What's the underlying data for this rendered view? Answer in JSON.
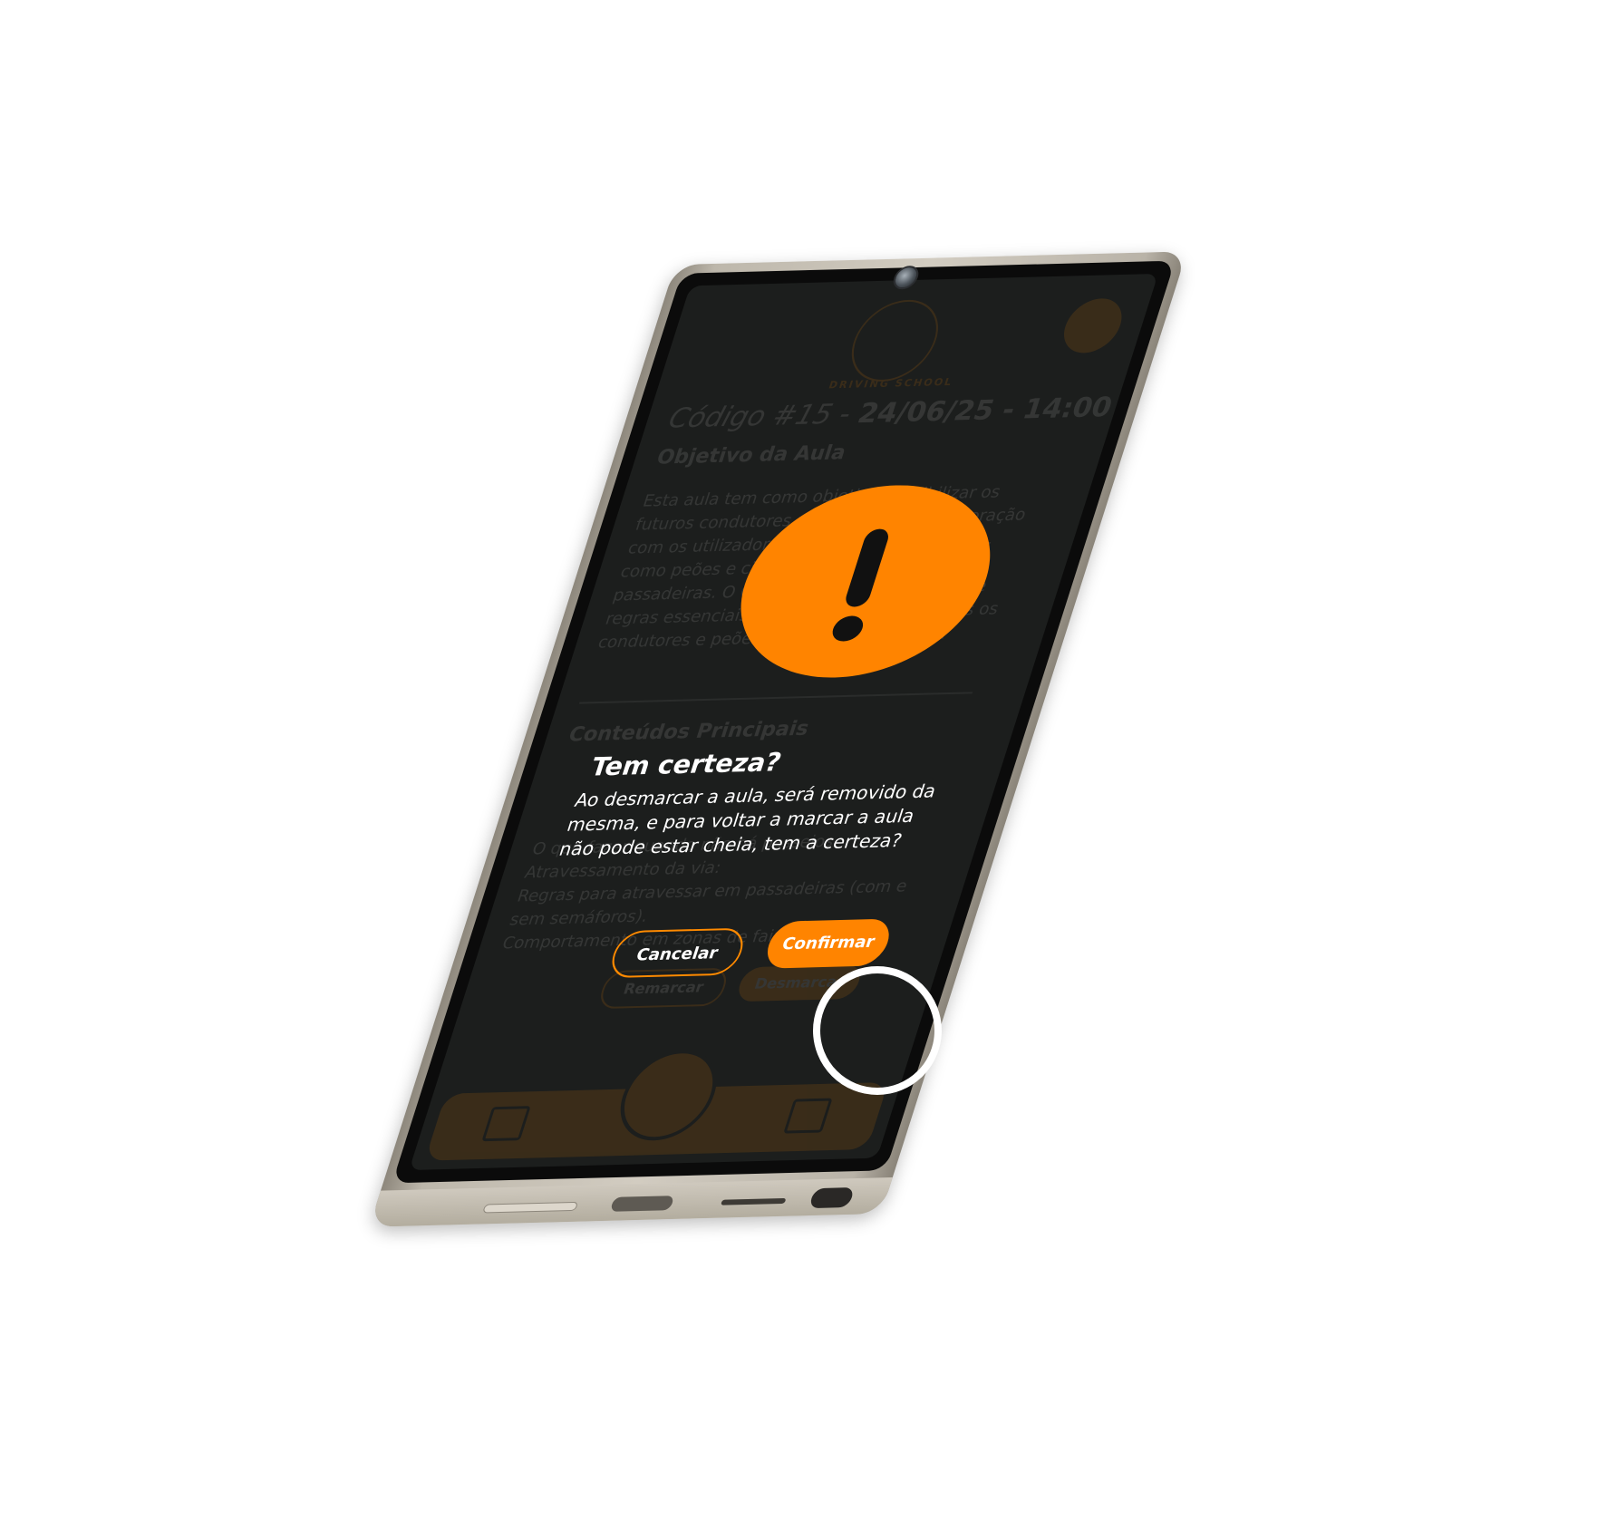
{
  "app": {
    "logo_text": "DRIVING SCHOOL",
    "lesson_title_prefix": "Código #15 - ",
    "lesson_title_date": "24/06/25 - 14:00",
    "objective_heading": "Objetivo da Aula",
    "objective_text": "Esta aula tem como objetivo sensibilizar os futuros condutores para a proteção e interação com os utilizadores mais vulneráveis da via, como peões e ciclistas, nos passeios e passadeiras. O Código da Estrada estabelece regras essenciais para a segurança de todos os condutores e peões para evitar acidentes.",
    "contents_heading": "Conteúdos Principais",
    "contents_items": [
      "O que fazer quando não há passeios.",
      "Atravessamento da via:",
      "Regras para atravessar em passadeiras (com e sem semáforos).",
      "Comportamento em zonas de faixas de peões."
    ],
    "bg_buttons": [
      "Remarcar",
      "Desmarcar"
    ]
  },
  "modal": {
    "title": "Tem certeza?",
    "message": "Ao desmarcar a aula, será removido da mesma, e para voltar a marcar a aula não pode estar cheia, tem a certeza?",
    "cancel_label": "Cancelar",
    "confirm_label": "Confirmar"
  },
  "icons": {
    "warning": "exclamation-icon",
    "nav_left": "calendar-icon",
    "nav_center": "home-icon",
    "nav_right": "receipt-icon"
  },
  "colors": {
    "accent": "#ff8400",
    "screen_bg": "#1c1e1d",
    "text": "#ffffff"
  }
}
